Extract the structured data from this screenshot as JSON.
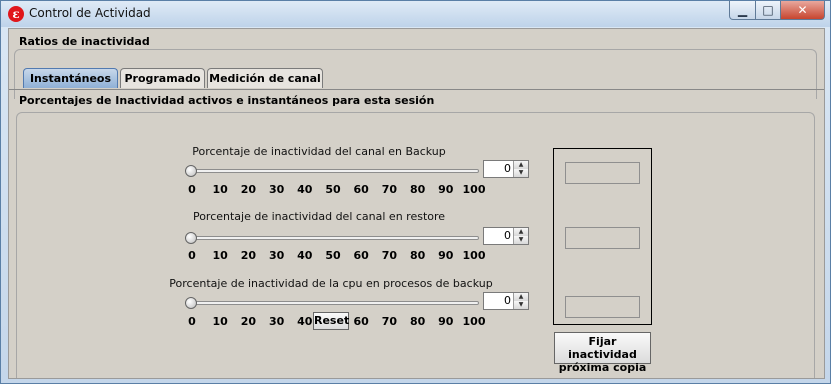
{
  "window": {
    "title": "Control de Actividad"
  },
  "section": {
    "title": "Ratios de inactividad"
  },
  "tabs": [
    {
      "label": "Instantáneos",
      "active": true
    },
    {
      "label": "Programado",
      "active": false
    },
    {
      "label": "Medición de canal",
      "active": false
    }
  ],
  "panel": {
    "heading": "Porcentajes de Inactividad activos e instantáneos para esta sesión"
  },
  "sliders": [
    {
      "label": "Porcentaje de inactividad del canal en Backup",
      "value": 0,
      "min": 0,
      "max": 100
    },
    {
      "label": "Porcentaje de inactividad del canal en restore",
      "value": 0,
      "min": 0,
      "max": 100
    },
    {
      "label": "Porcentaje de inactividad de la cpu en procesos de backup",
      "value": 0,
      "min": 0,
      "max": 100
    }
  ],
  "ticks": [
    0,
    10,
    20,
    30,
    40,
    50,
    60,
    70,
    80,
    90,
    100
  ],
  "buttons": {
    "reset": "Reset",
    "fix_line1": "Fijar inactividad",
    "fix_line2": "próxima copia"
  },
  "icons": {
    "app": "app-logo-icon",
    "minimize": "minimize-icon",
    "maximize": "maximize-icon",
    "close": "close-icon",
    "spin_up": "triangle-up-icon",
    "spin_down": "triangle-down-icon"
  },
  "colors": {
    "active_tab": "#8fb0d6",
    "close_button": "#c7452f",
    "app_logo": "#e0161b"
  }
}
